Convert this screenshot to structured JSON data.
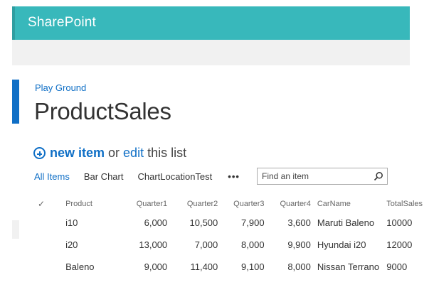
{
  "suite": {
    "brand": "SharePoint"
  },
  "breadcrumb": "Play Ground",
  "page_title": "ProductSales",
  "command": {
    "new_item": "new item",
    "or": "or",
    "edit": "edit",
    "this_list": "this list"
  },
  "views": [
    "All Items",
    "Bar Chart",
    "ChartLocationTest"
  ],
  "views_more": "•••",
  "search": {
    "placeholder": "Find an item"
  },
  "table": {
    "columns": [
      "Product",
      "Quarter1",
      "Quarter2",
      "Quarter3",
      "Quarter4",
      "CarName",
      "TotalSales"
    ],
    "rows": [
      [
        "i10",
        "6,000",
        "10,500",
        "7,900",
        "3,600",
        "Maruti Baleno",
        "10000"
      ],
      [
        "i20",
        "13,000",
        "7,000",
        "8,000",
        "9,900",
        "Hyundai i20",
        "12000"
      ],
      [
        "Baleno",
        "9,000",
        "11,400",
        "9,100",
        "8,000",
        "Nissan Terrano",
        "9000"
      ]
    ]
  },
  "colors": {
    "suite_bar": "#38b8bb",
    "accent": "#0f6fc6",
    "ribbon": "#f1f1f1"
  }
}
